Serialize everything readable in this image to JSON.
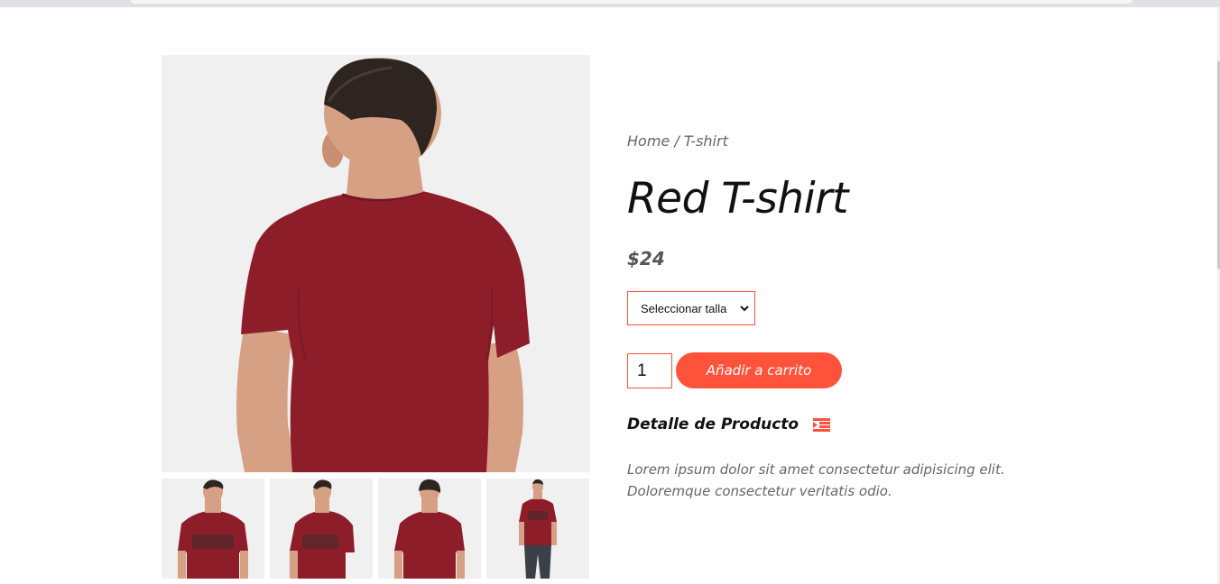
{
  "product": {
    "breadcrumb": {
      "home": "Home",
      "separator": " / ",
      "current": "T-shirt"
    },
    "title": "Red T-shirt",
    "price": "$24",
    "size_select": {
      "selected": "Seleccionar talla"
    },
    "quantity": "1",
    "add_to_cart": "Añadir a carrito",
    "detail_heading": "Detalle de Producto",
    "description_line1": "Lorem ipsum dolor sit amet consectetur adipisicing elit.",
    "description_line2": "Doloremque consectetur veritatis odio."
  },
  "icons": {
    "detail": "indent-icon",
    "select": "chevron-down-icon"
  },
  "gallery": {
    "main": "red-tshirt-back",
    "thumbnails": [
      "red-tshirt-front",
      "red-tshirt-side",
      "red-tshirt-back",
      "red-tshirt-full-body"
    ]
  },
  "colors": {
    "accent": "#ff523b",
    "shirt": "#8e1d2a",
    "image_bg": "#f0f0f0"
  }
}
